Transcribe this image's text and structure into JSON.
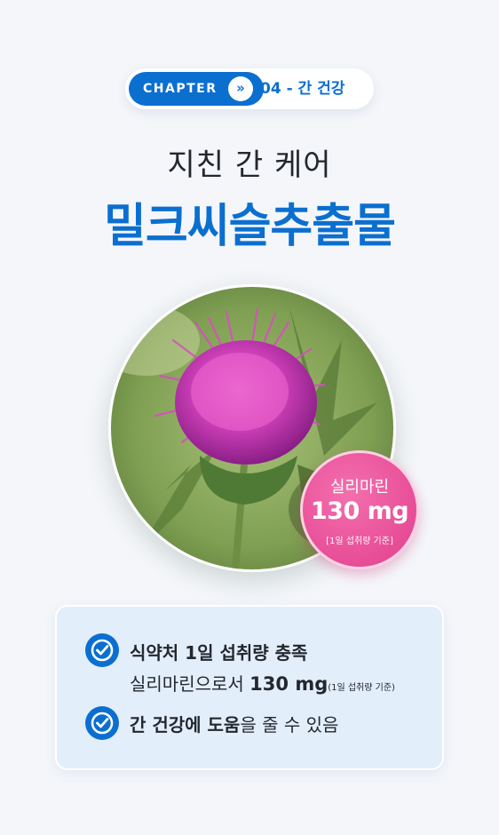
{
  "chapter": {
    "label": "CHAPTER",
    "arrow_icon": "double-chevron-right",
    "number_topic": "04 - 간 건강"
  },
  "heading": {
    "subtitle": "지친 간 케어",
    "title": "밀크씨슬추출물"
  },
  "image": {
    "subject": "milk thistle flower"
  },
  "badge": {
    "name": "실리마린",
    "value": "130 mg",
    "basis": "[1일 섭취량 기준]"
  },
  "info": {
    "item1": {
      "line1": "식약처 1일 섭취량 충족",
      "line2_prefix": "실리마린으로서 ",
      "line2_value": "130 mg",
      "line2_note": "(1일 섭취량 기준)"
    },
    "item2": {
      "bold": "간 건강에 도움",
      "rest": "을 줄 수 있음"
    }
  },
  "colors": {
    "brand_blue": "#0b6fd0",
    "badge_pink": "#e8529a",
    "background": "#f4f6fa",
    "info_bg": "#e3eefb"
  }
}
